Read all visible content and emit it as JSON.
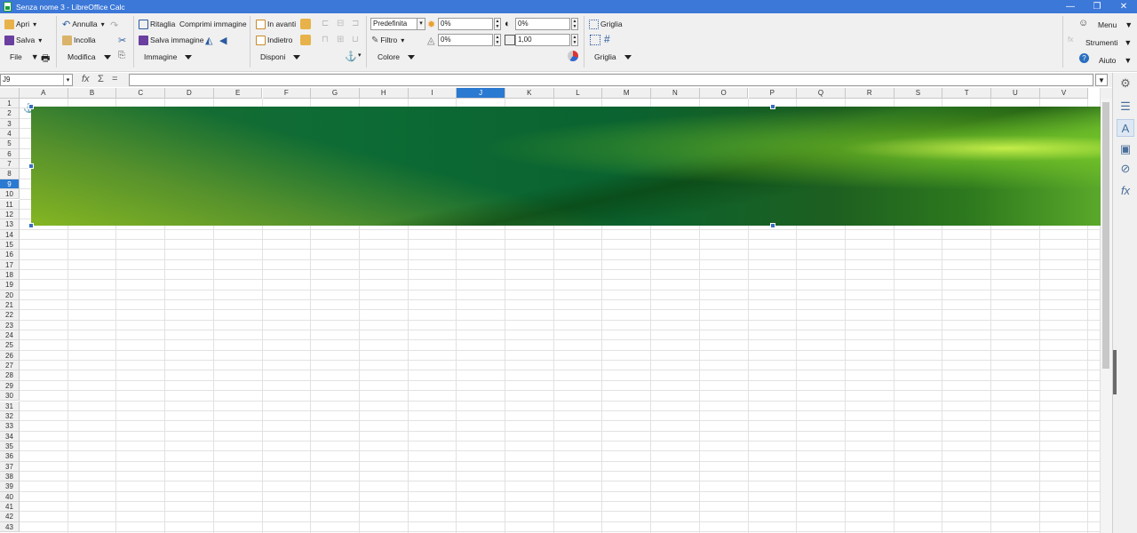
{
  "window": {
    "title": "Senza nome 3 - LibreOffice Calc",
    "minimize": "—",
    "restore": "❐",
    "close": "✕"
  },
  "toolbar": {
    "apri": "Apri",
    "salva": "Salva",
    "file": "File",
    "annulla": "Annulla",
    "incolla": "Incolla",
    "modifica": "Modifica",
    "ritaglia": "Ritaglia",
    "comprimi": "Comprimi immagine",
    "salva_immagine": "Salva immagine",
    "immagine": "Immagine",
    "in_avanti": "In avanti",
    "indietro": "Indietro",
    "disponi": "Disponi",
    "style_value": "Predefinita",
    "filtro": "Filtro",
    "colore": "Colore",
    "brightness": "0%",
    "contrast": "0%",
    "transparency": "0%",
    "gamma": "1,00",
    "griglia_top": "Griglia",
    "griglia": "Griglia",
    "menu": "Menu",
    "strumenti": "Strumenti",
    "aiuto": "Aiuto"
  },
  "formula_bar": {
    "name_box": "J9",
    "fx": "fx",
    "sum": "Σ",
    "equals": "=",
    "formula": ""
  },
  "sheet": {
    "columns": [
      "A",
      "B",
      "C",
      "D",
      "E",
      "F",
      "G",
      "H",
      "I",
      "J",
      "K",
      "L",
      "M",
      "N",
      "O",
      "P",
      "Q",
      "R",
      "S",
      "T",
      "U",
      "V"
    ],
    "selected_column": "J",
    "rows": [
      "1",
      "2",
      "3",
      "4",
      "5",
      "6",
      "7",
      "8",
      "9",
      "10",
      "11",
      "12",
      "13",
      "14",
      "15",
      "16",
      "17",
      "18",
      "19",
      "20",
      "21",
      "22",
      "23",
      "24",
      "25",
      "26",
      "27",
      "28",
      "29",
      "30",
      "31",
      "32",
      "33",
      "34",
      "35",
      "36",
      "37",
      "38",
      "39",
      "40",
      "41",
      "42",
      "43"
    ],
    "selected_row": "9",
    "active_cell": "J9"
  },
  "colors": {
    "titlebar": "#3c78d8",
    "selection": "#2a7ad2",
    "handle": "#3a6ec0"
  }
}
